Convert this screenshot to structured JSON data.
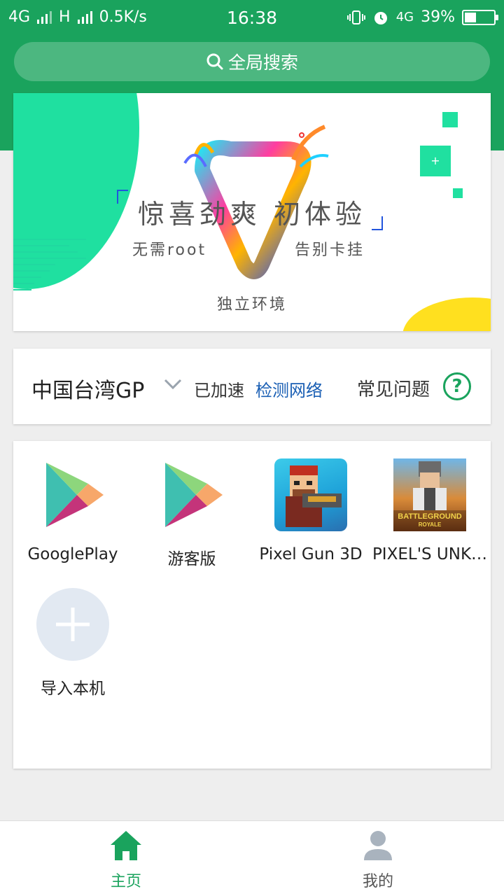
{
  "statusbar": {
    "network1": "4G",
    "network2": "H",
    "speed": "0.5K/s",
    "time": "16:38",
    "network3": "4G",
    "battery": "39%",
    "battery_level": 0.39
  },
  "search": {
    "label": "全局搜索"
  },
  "banner": {
    "headline": "惊喜劲爽  初体验",
    "sub_left": "无需root",
    "sub_right": "告别卡挂",
    "sub_bottom": "独立环境",
    "plus": "+"
  },
  "server": {
    "region": "中国台湾GP",
    "status": "已加速",
    "check_network": "检测网络",
    "faq": "常见问题",
    "help": "?"
  },
  "apps": [
    {
      "label": "GooglePlay",
      "icon": "google-play-icon"
    },
    {
      "label": "游客版",
      "icon": "google-play-icon"
    },
    {
      "label": "Pixel Gun 3D",
      "icon": "pixel-gun-icon"
    },
    {
      "label": "PIXEL'S UNK…",
      "icon": "pubg-icon",
      "icon_text_1": "BATTLEGROUND",
      "icon_text_2": "ROYALE"
    }
  ],
  "import": {
    "label": "导入本机",
    "icon": "plus-icon"
  },
  "nav": {
    "home": "主页",
    "mine": "我的",
    "active_color": "#1aa35d",
    "inactive_color": "#a9b3be"
  }
}
